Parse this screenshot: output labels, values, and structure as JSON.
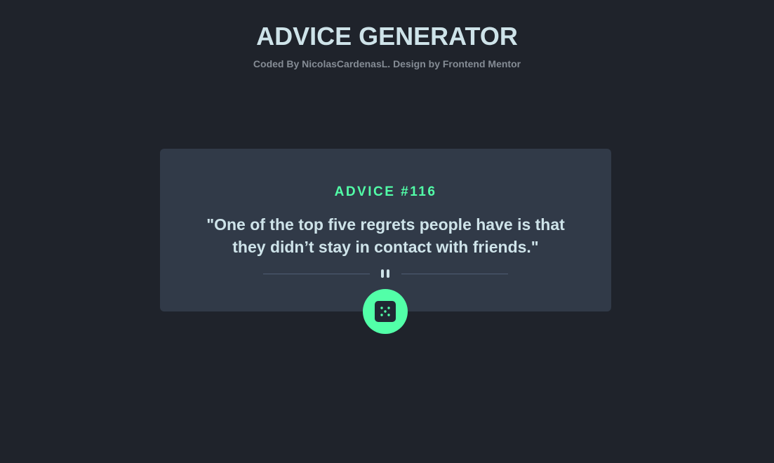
{
  "header": {
    "title": "ADVICE GENERATOR",
    "credit": "Coded By NicolasCardenasL. Design by Frontend Mentor"
  },
  "advice": {
    "label": "ADVICE #116",
    "quote": "\"One of the top five regrets people have is that they didn’t stay in contact with friends.\""
  },
  "icons": {
    "divider": "pause-icon",
    "button": "dice-icon"
  },
  "colors": {
    "background": "#1f232b",
    "card": "#313a48",
    "accent": "#52ffa8",
    "text": "#cee3e9",
    "muted": "#858c95",
    "divider": "#4f5d74"
  }
}
